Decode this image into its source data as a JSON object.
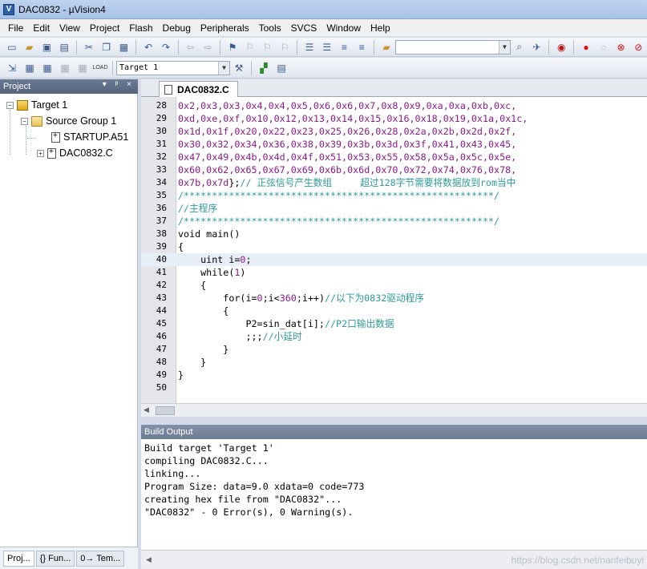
{
  "window": {
    "title": "DAC0832 - µVision4",
    "app_icon": "V"
  },
  "menu": [
    "File",
    "Edit",
    "View",
    "Project",
    "Flash",
    "Debug",
    "Peripherals",
    "Tools",
    "SVCS",
    "Window",
    "Help"
  ],
  "toolbar2": {
    "target_select": "Target 1"
  },
  "project_panel": {
    "title": "Project",
    "header_buttons": "▾ ᵖ ×",
    "tree": {
      "target": "Target 1",
      "group": "Source Group 1",
      "files": [
        "STARTUP.A51",
        "DAC0832.C"
      ]
    },
    "tabs": [
      "Proj...",
      "{} Fun...",
      "0→ Tem..."
    ]
  },
  "editor": {
    "tab": "DAC0832.C",
    "current_line": 40,
    "lines": [
      {
        "n": "28",
        "parts": [
          {
            "t": "0x2,0x3,0x3,0x4,0x4,0x5,0x6,0x6,0x7,0x8,0x9,0xa,0xa,0xb,0xc,",
            "c": "c-hex"
          }
        ]
      },
      {
        "n": "29",
        "parts": [
          {
            "t": "0xd,0xe,0xf,0x10,0x12,0x13,0x14,0x15,0x16,0x18,0x19,0x1a,0x1c,",
            "c": "c-hex"
          }
        ]
      },
      {
        "n": "30",
        "parts": [
          {
            "t": "0x1d,0x1f,0x20,0x22,0x23,0x25,0x26,0x28,0x2a,0x2b,0x2d,0x2f,",
            "c": "c-hex"
          }
        ]
      },
      {
        "n": "31",
        "parts": [
          {
            "t": "0x30,0x32,0x34,0x36,0x38,0x39,0x3b,0x3d,0x3f,0x41,0x43,0x45,",
            "c": "c-hex"
          }
        ]
      },
      {
        "n": "32",
        "parts": [
          {
            "t": "0x47,0x49,0x4b,0x4d,0x4f,0x51,0x53,0x55,0x58,0x5a,0x5c,0x5e,",
            "c": "c-hex"
          }
        ]
      },
      {
        "n": "33",
        "parts": [
          {
            "t": "0x60,0x62,0x65,0x67,0x69,0x6b,0x6d,0x70,0x72,0x74,0x76,0x78,",
            "c": "c-hex"
          }
        ]
      },
      {
        "n": "34",
        "parts": [
          {
            "t": "0x7b,0x7d",
            "c": "c-hex"
          },
          {
            "t": "};",
            "c": "c-kw"
          },
          {
            "t": "// 正弦信号产生数组     超过128字节需要将数据放到rom当中",
            "c": "c-cmt"
          }
        ]
      },
      {
        "n": "35",
        "parts": [
          {
            "t": "/*******************************************************/",
            "c": "c-cmt"
          }
        ]
      },
      {
        "n": "36",
        "parts": [
          {
            "t": "//主程序",
            "c": "c-cmt"
          }
        ]
      },
      {
        "n": "37",
        "parts": [
          {
            "t": "/*******************************************************/",
            "c": "c-cmt"
          }
        ]
      },
      {
        "n": "38",
        "parts": [
          {
            "t": "void main()",
            "c": "c-kw"
          }
        ]
      },
      {
        "n": "39",
        "parts": [
          {
            "t": "{",
            "c": "c-kw"
          }
        ]
      },
      {
        "n": "40",
        "parts": [
          {
            "t": "    uint i=",
            "c": "c-kw"
          },
          {
            "t": "0",
            "c": "c-num"
          },
          {
            "t": ";",
            "c": "c-kw"
          }
        ]
      },
      {
        "n": "41",
        "parts": [
          {
            "t": "    while(",
            "c": "c-kw"
          },
          {
            "t": "1",
            "c": "c-num"
          },
          {
            "t": ")",
            "c": "c-kw"
          }
        ]
      },
      {
        "n": "42",
        "parts": [
          {
            "t": "    {",
            "c": "c-kw"
          }
        ]
      },
      {
        "n": "43",
        "parts": [
          {
            "t": "        for(i=",
            "c": "c-kw"
          },
          {
            "t": "0",
            "c": "c-num"
          },
          {
            "t": ";i<",
            "c": "c-kw"
          },
          {
            "t": "360",
            "c": "c-num"
          },
          {
            "t": ";i++)",
            "c": "c-kw"
          },
          {
            "t": "//以下为0832驱动程序",
            "c": "c-cmt"
          }
        ]
      },
      {
        "n": "44",
        "parts": [
          {
            "t": "        {",
            "c": "c-kw"
          }
        ]
      },
      {
        "n": "45",
        "parts": [
          {
            "t": "            P2=sin_dat[i];",
            "c": "c-kw"
          },
          {
            "t": "//P2口输出数据",
            "c": "c-cmt"
          }
        ]
      },
      {
        "n": "46",
        "parts": [
          {
            "t": "            ;;;",
            "c": "c-kw"
          },
          {
            "t": "//小延时",
            "c": "c-cmt"
          }
        ]
      },
      {
        "n": "47",
        "parts": [
          {
            "t": "        }",
            "c": "c-kw"
          }
        ]
      },
      {
        "n": "48",
        "parts": [
          {
            "t": "    }",
            "c": "c-kw"
          }
        ]
      },
      {
        "n": "49",
        "parts": [
          {
            "t": "}",
            "c": "c-kw"
          }
        ]
      },
      {
        "n": "50",
        "parts": [
          {
            "t": "",
            "c": "c-kw"
          }
        ]
      }
    ]
  },
  "build_output": {
    "title": "Build Output",
    "lines": [
      "Build target 'Target 1'",
      "compiling DAC0832.C...",
      "linking...",
      "Program Size: data=9.0 xdata=0 code=773",
      "creating hex file from \"DAC0832\"...",
      "\"DAC0832\" - 0 Error(s), 0 Warning(s)."
    ],
    "watermark": "https://blog.csdn.net/nanfeibuyi"
  },
  "colors": {
    "hex": "#8b1a8b",
    "comment": "#2e9a9a",
    "panel_header": "#5e6c85"
  }
}
